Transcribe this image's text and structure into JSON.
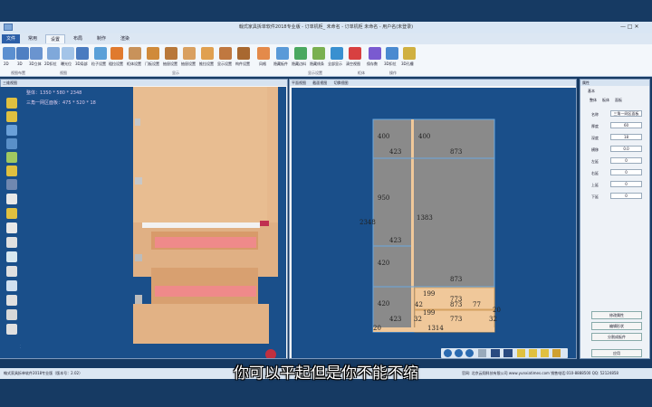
{
  "window": {
    "title": "翰式家具拆单软件2018专业版 - 订单机柜_ 未命名 - 订单机柜 未命名 - 用户名(未登录)"
  },
  "tabs": [
    "文件",
    "常用",
    "设置",
    "布局",
    "制作",
    "渲染"
  ],
  "ribbon": {
    "items": [
      "2D",
      "3D",
      "3D立体",
      "2D扣位",
      "曝光位",
      "3D局部",
      "粒子设置",
      "粗拉设置",
      "柜体设置",
      "门板设置",
      "抽屉设置",
      "抽屉设置",
      "推拉设置",
      "显示设置",
      "构件设置",
      "风格",
      "隐藏板件",
      "隐藏边料",
      "隐藏线条",
      "全部显示",
      "清空视图",
      "保存数",
      "3D扣位",
      "3D孔槽"
    ],
    "groups": [
      "视图布置",
      "视图",
      "显示",
      "显示设置",
      "柜体",
      "操作"
    ]
  },
  "left_panel": {
    "title": "三维视图",
    "dim_main": "整体：1350 * 580 * 2348",
    "dim_sub": "三角一网区面板：475 * 520 * 18",
    "axis": "Z  Y  X"
  },
  "right_panel": {
    "tabs": [
      "平面视图",
      "截面视图",
      "切换视图"
    ],
    "dims": {
      "top_left": "400",
      "top_right": "400",
      "w1": "423",
      "w2": "873",
      "h950": "950",
      "w3": "423",
      "h1383": "1383",
      "tall": "2348",
      "h420a": "420",
      "w4": "873",
      "h420b": "420",
      "w5": "423",
      "s199a": "199",
      "s773a": "773",
      "s199b": "199",
      "s773b": "773",
      "w6": "873",
      "g32a": "32",
      "g32b": "32",
      "b1314": "1314",
      "n20": "20",
      "n42": "42",
      "n77": "77",
      "n20b": "20"
    }
  },
  "props": {
    "header": "属性",
    "sub": "基本",
    "tabs": [
      "整体",
      "板体",
      "面板"
    ],
    "rows": [
      {
        "label": "名称",
        "value": "三角一网区面板"
      },
      {
        "label": "厚度",
        "value": "60"
      },
      {
        "label": "深度",
        "value": "18"
      },
      {
        "label": "横移",
        "value": "0.0"
      },
      {
        "label": "左延",
        "value": "0"
      },
      {
        "label": "右延",
        "value": "0"
      },
      {
        "label": "上延",
        "value": "0"
      },
      {
        "label": "下延",
        "value": "0"
      }
    ],
    "buttons": [
      "修改属性",
      "编辑形状",
      "分割成板件",
      "应用"
    ]
  },
  "status": {
    "left": "翰式家具拆单软件2018专业版（版本号：2.02）",
    "right": "官网: 北京云翔科技有限公司 www.yunxiatimes.com  销售电话:010-8888500  QQ: 52124858"
  },
  "subtitle": "你可以平起但是你不能不缩"
}
